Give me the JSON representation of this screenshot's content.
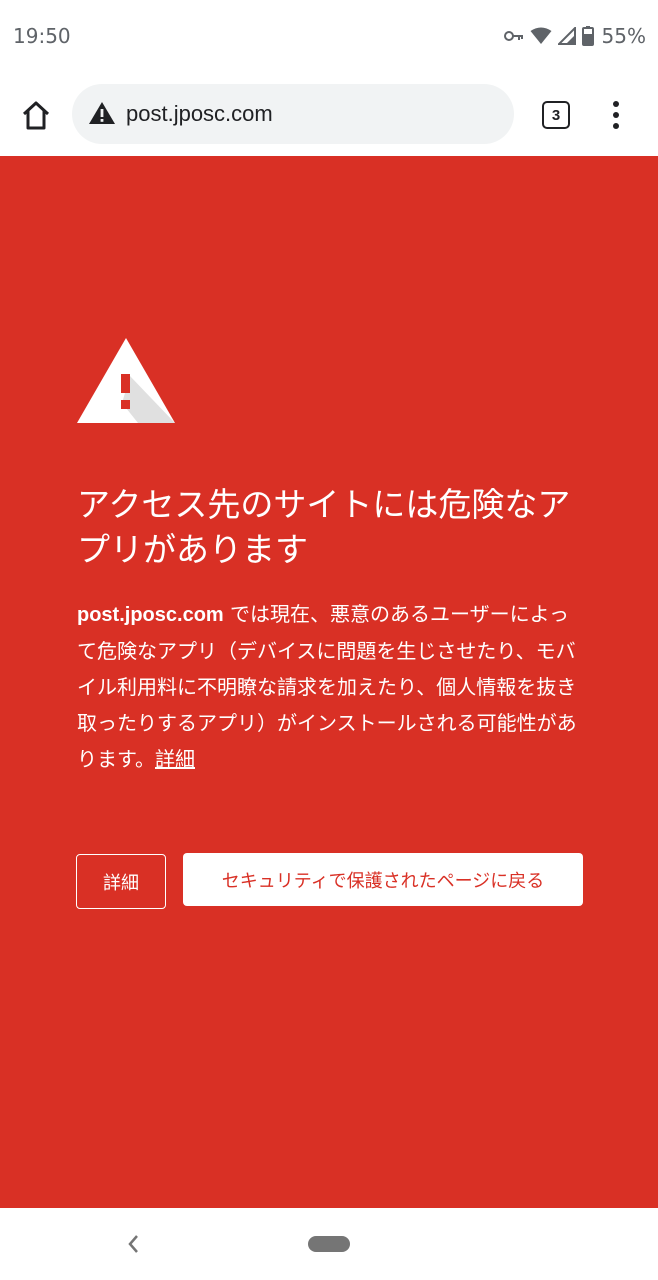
{
  "status_bar": {
    "time": "19:50",
    "battery_percent": "55%",
    "icons": [
      "vpn-key-icon",
      "wifi-icon",
      "cell-signal-icon",
      "battery-icon"
    ]
  },
  "toolbar": {
    "home_icon": "home-icon",
    "url": "post.jposc.com",
    "url_security_icon": "warning-triangle-icon",
    "tab_count": "3",
    "menu_icon": "more-vert-icon"
  },
  "interstitial": {
    "background_color": "#d93025",
    "heading": "アクセス先のサイトには危険なアプリがあります",
    "domain": "post.jposc.com",
    "body": " では現在、悪意のあるユーザーによって危険なアプリ（デバイスに問題を生じさせたり、モバイル利用料に不明瞭な請求を加えたり、個人情報を抜き取ったりするアプリ）がインストールされる可能性があります。",
    "details_link": "詳細",
    "details_button": "詳細",
    "back_button": "セキュリティで保護されたページに戻る"
  },
  "nav_bar": {
    "back_icon": "nav-back-icon",
    "home_icon": "nav-home-pill-icon"
  }
}
